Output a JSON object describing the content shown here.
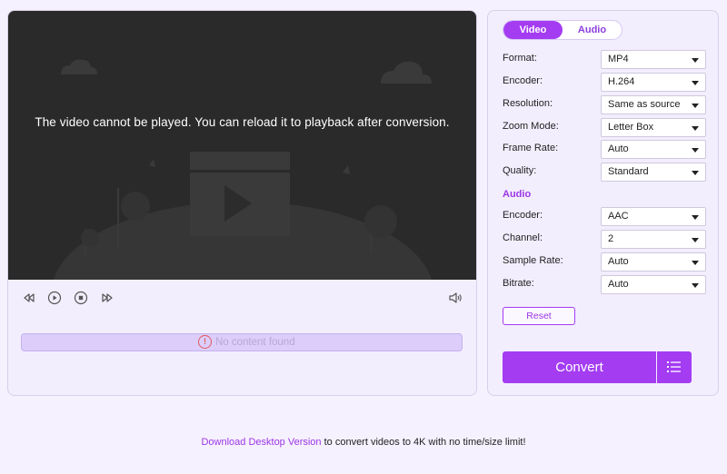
{
  "video": {
    "message": "The video cannot be played. You can reload it to playback after conversion.",
    "no_content": "No content found"
  },
  "tabs": [
    {
      "label": "Video"
    },
    {
      "label": "Audio"
    }
  ],
  "video_settings": [
    {
      "label": "Format:",
      "value": "MP4"
    },
    {
      "label": "Encoder:",
      "value": "H.264"
    },
    {
      "label": "Resolution:",
      "value": "Same as source"
    },
    {
      "label": "Zoom Mode:",
      "value": "Letter Box"
    },
    {
      "label": "Frame Rate:",
      "value": "Auto"
    },
    {
      "label": "Quality:",
      "value": "Standard"
    }
  ],
  "audio_heading": "Audio",
  "audio_settings": [
    {
      "label": "Encoder:",
      "value": "AAC"
    },
    {
      "label": "Channel:",
      "value": "2"
    },
    {
      "label": "Sample Rate:",
      "value": "Auto"
    },
    {
      "label": "Bitrate:",
      "value": "Auto"
    }
  ],
  "reset_label": "Reset",
  "convert_label": "Convert",
  "footer": {
    "link": "Download Desktop Version",
    "text": " to convert videos to 4K with no time/size limit!"
  },
  "colors": {
    "accent": "#a43cf2",
    "background": "#f6f1ff",
    "video_bg": "#2a2a2a"
  },
  "icons": [
    "rewind-icon",
    "play-icon",
    "stop-icon",
    "fast-forward-icon",
    "volume-icon",
    "warning-icon",
    "list-icon"
  ]
}
